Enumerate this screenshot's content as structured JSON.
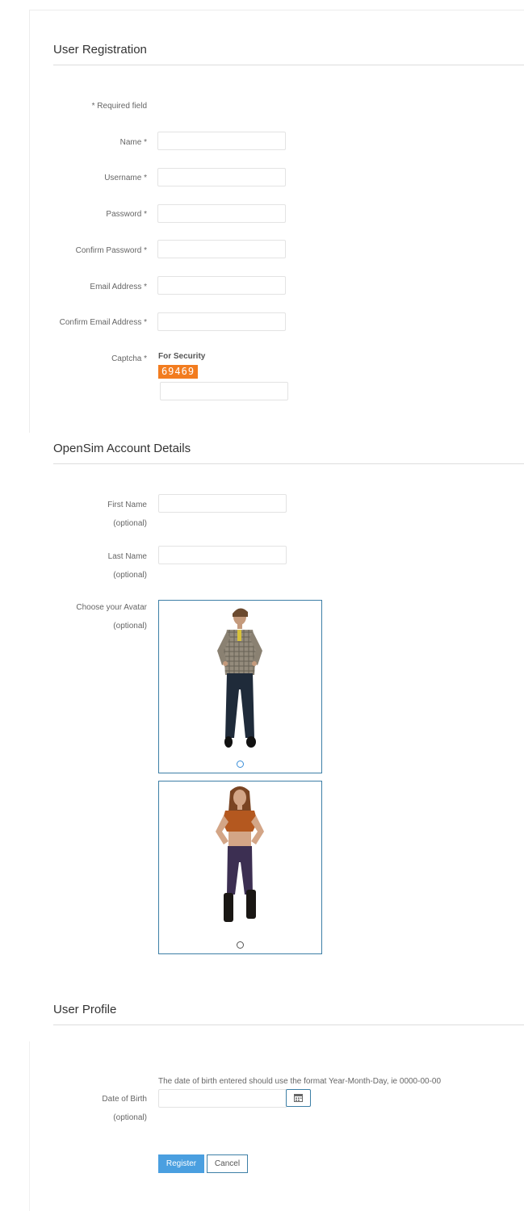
{
  "registration": {
    "title": "User Registration",
    "required_note": "* Required field",
    "fields": {
      "name": "Name *",
      "username": "Username *",
      "password": "Password *",
      "confirm_password": "Confirm Password *",
      "email": "Email Address *",
      "confirm_email": "Confirm Email Address *",
      "captcha": "Captcha *"
    },
    "captcha_title": "For Security",
    "captcha_code": "69469"
  },
  "opensim": {
    "title": "OpenSim Account Details",
    "first_name": "First Name",
    "last_name": "Last Name",
    "avatar": "Choose your Avatar",
    "optional": "(optional)",
    "avatars": [
      {
        "icon": "male-avatar",
        "selected": false
      },
      {
        "icon": "female-avatar",
        "selected": false
      }
    ]
  },
  "profile": {
    "title": "User Profile",
    "dob_hint": "The date of birth entered should use the format Year-Month-Day, ie 0000-00-00",
    "dob_label": "Date of Birth",
    "optional": "(optional)",
    "calendar_icon": "calendar-icon"
  },
  "actions": {
    "register": "Register",
    "cancel": "Cancel"
  },
  "colors": {
    "primary": "#4a9fe0",
    "border_accent": "#3d7fa6",
    "captcha_bg": "#f27c1f"
  }
}
